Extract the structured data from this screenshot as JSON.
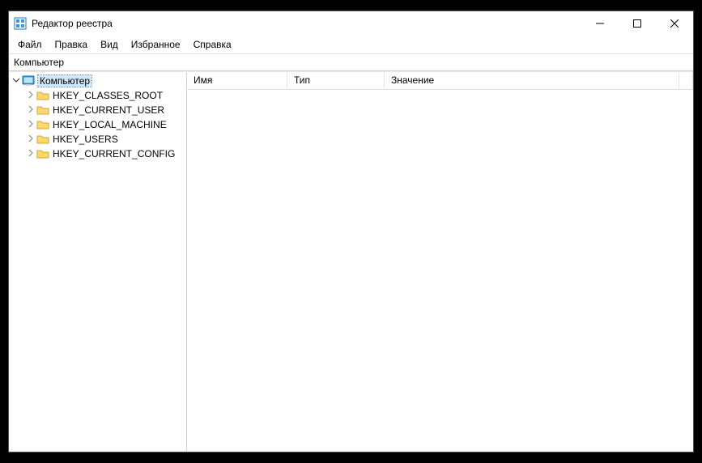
{
  "window": {
    "title": "Редактор реестра"
  },
  "menu": {
    "items": [
      "Файл",
      "Правка",
      "Вид",
      "Избранное",
      "Справка"
    ]
  },
  "address": "Компьютер",
  "tree": {
    "root": {
      "label": "Компьютер",
      "expanded": true,
      "selected": true,
      "children": [
        {
          "label": "HKEY_CLASSES_ROOT"
        },
        {
          "label": "HKEY_CURRENT_USER"
        },
        {
          "label": "HKEY_LOCAL_MACHINE"
        },
        {
          "label": "HKEY_USERS"
        },
        {
          "label": "HKEY_CURRENT_CONFIG"
        }
      ]
    }
  },
  "list": {
    "columns": {
      "name": "Имя",
      "type": "Тип",
      "value": "Значение"
    }
  }
}
